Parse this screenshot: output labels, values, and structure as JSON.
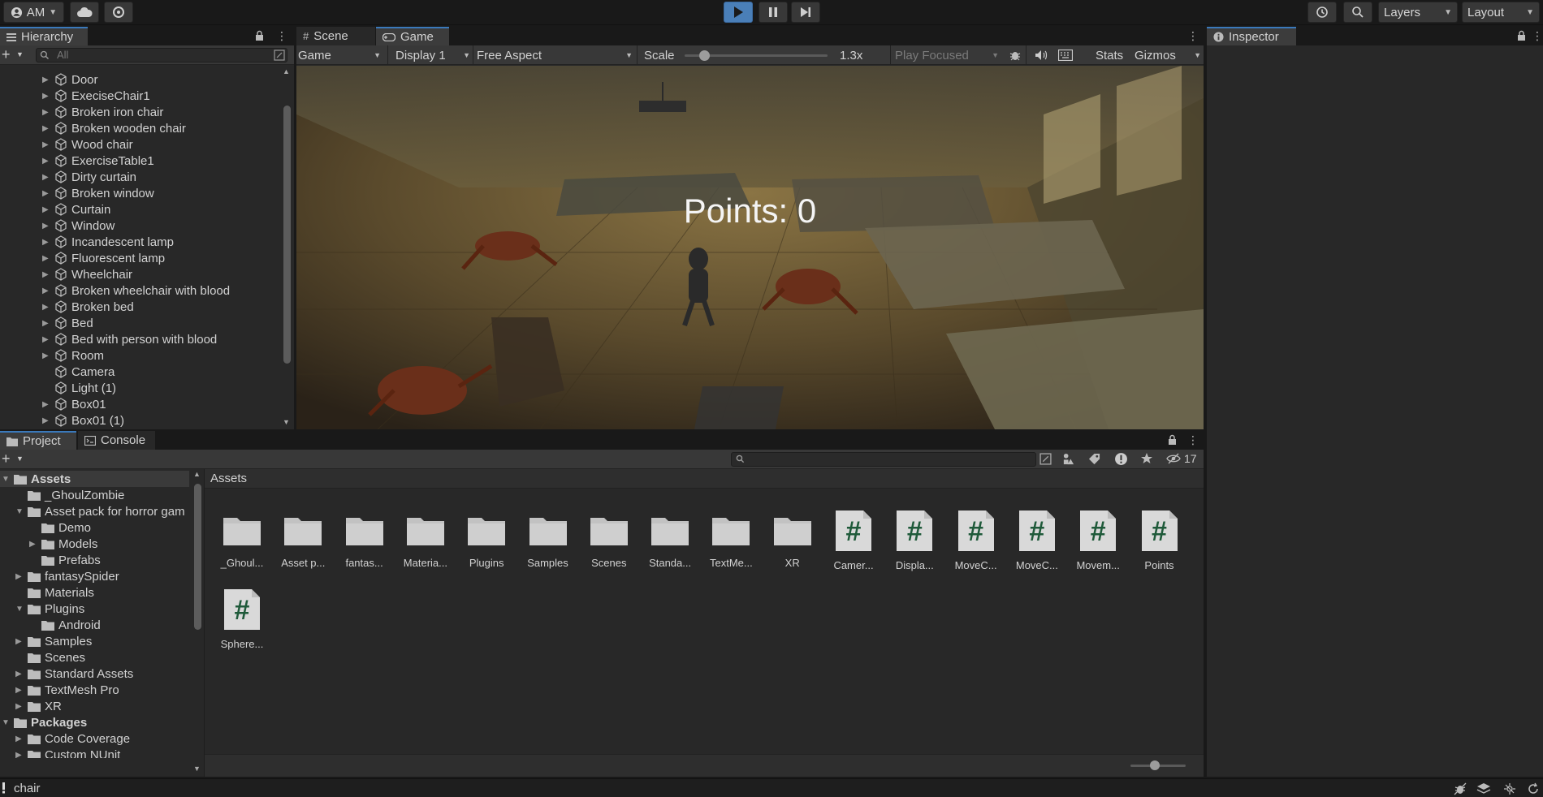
{
  "toolbar": {
    "account_label": "AM",
    "layers_label": "Layers",
    "layout_label": "Layout"
  },
  "hierarchy": {
    "tab_label": "Hierarchy",
    "search_placeholder": "All",
    "items": [
      {
        "label": "Door",
        "expandable": true
      },
      {
        "label": "ExeciseChair1",
        "expandable": true
      },
      {
        "label": "Broken iron chair",
        "expandable": true
      },
      {
        "label": "Broken wooden chair",
        "expandable": true
      },
      {
        "label": "Wood chair",
        "expandable": true
      },
      {
        "label": "ExerciseTable1",
        "expandable": true
      },
      {
        "label": "Dirty curtain",
        "expandable": true
      },
      {
        "label": "Broken window",
        "expandable": true
      },
      {
        "label": "Curtain",
        "expandable": true
      },
      {
        "label": "Window",
        "expandable": true
      },
      {
        "label": "Incandescent lamp",
        "expandable": true
      },
      {
        "label": "Fluorescent lamp",
        "expandable": true
      },
      {
        "label": "Wheelchair",
        "expandable": true
      },
      {
        "label": "Broken wheelchair with blood",
        "expandable": true
      },
      {
        "label": "Broken bed",
        "expandable": true
      },
      {
        "label": "Bed",
        "expandable": true
      },
      {
        "label": "Bed with person with blood",
        "expandable": true
      },
      {
        "label": "Room",
        "expandable": true
      },
      {
        "label": "Camera",
        "expandable": false
      },
      {
        "label": "Light (1)",
        "expandable": false
      },
      {
        "label": "Box01",
        "expandable": true
      },
      {
        "label": "Box01 (1)",
        "expandable": true
      }
    ]
  },
  "game": {
    "tab_scene": "Scene",
    "tab_game": "Game",
    "view_mode": "Game",
    "display": "Display 1",
    "aspect": "Free Aspect",
    "scale_label": "Scale",
    "scale_value": "1.3x",
    "play_mode": "Play Focused",
    "stats_label": "Stats",
    "gizmos_label": "Gizmos",
    "hud_points": "Points: 0"
  },
  "inspector": {
    "tab_label": "Inspector"
  },
  "project": {
    "tab_project": "Project",
    "tab_console": "Console",
    "hidden_count": "17",
    "breadcrumb": "Assets",
    "tree": [
      {
        "label": "Assets",
        "indent": 0,
        "state": "open",
        "bold": true
      },
      {
        "label": "_GhoulZombie",
        "indent": 1,
        "state": "none"
      },
      {
        "label": "Asset pack for horror gam",
        "indent": 1,
        "state": "open"
      },
      {
        "label": "Demo",
        "indent": 2,
        "state": "none"
      },
      {
        "label": "Models",
        "indent": 2,
        "state": "closed"
      },
      {
        "label": "Prefabs",
        "indent": 2,
        "state": "none"
      },
      {
        "label": "fantasySpider",
        "indent": 1,
        "state": "closed"
      },
      {
        "label": "Materials",
        "indent": 1,
        "state": "none"
      },
      {
        "label": "Plugins",
        "indent": 1,
        "state": "open"
      },
      {
        "label": "Android",
        "indent": 2,
        "state": "none"
      },
      {
        "label": "Samples",
        "indent": 1,
        "state": "closed"
      },
      {
        "label": "Scenes",
        "indent": 1,
        "state": "none"
      },
      {
        "label": "Standard Assets",
        "indent": 1,
        "state": "closed"
      },
      {
        "label": "TextMesh Pro",
        "indent": 1,
        "state": "closed"
      },
      {
        "label": "XR",
        "indent": 1,
        "state": "closed"
      },
      {
        "label": "Packages",
        "indent": 0,
        "state": "open",
        "bold": true
      },
      {
        "label": "Code Coverage",
        "indent": 1,
        "state": "closed"
      },
      {
        "label": "Custom NUnit",
        "indent": 1,
        "state": "closed"
      }
    ],
    "assets": [
      {
        "label": "_Ghoul...",
        "kind": "folder"
      },
      {
        "label": "Asset p...",
        "kind": "folder"
      },
      {
        "label": "fantas...",
        "kind": "folder"
      },
      {
        "label": "Materia...",
        "kind": "folder"
      },
      {
        "label": "Plugins",
        "kind": "folder"
      },
      {
        "label": "Samples",
        "kind": "folder"
      },
      {
        "label": "Scenes",
        "kind": "folder"
      },
      {
        "label": "Standa...",
        "kind": "folder"
      },
      {
        "label": "TextMe...",
        "kind": "folder"
      },
      {
        "label": "XR",
        "kind": "folder"
      },
      {
        "label": "Camer...",
        "kind": "script"
      },
      {
        "label": "Displa...",
        "kind": "script"
      },
      {
        "label": "MoveC...",
        "kind": "script"
      },
      {
        "label": "MoveC...",
        "kind": "script"
      },
      {
        "label": "Movem...",
        "kind": "script"
      },
      {
        "label": "Points",
        "kind": "script"
      },
      {
        "label": "Sphere...",
        "kind": "script"
      }
    ],
    "script_glyph": "#"
  },
  "status": {
    "message": "chair"
  }
}
